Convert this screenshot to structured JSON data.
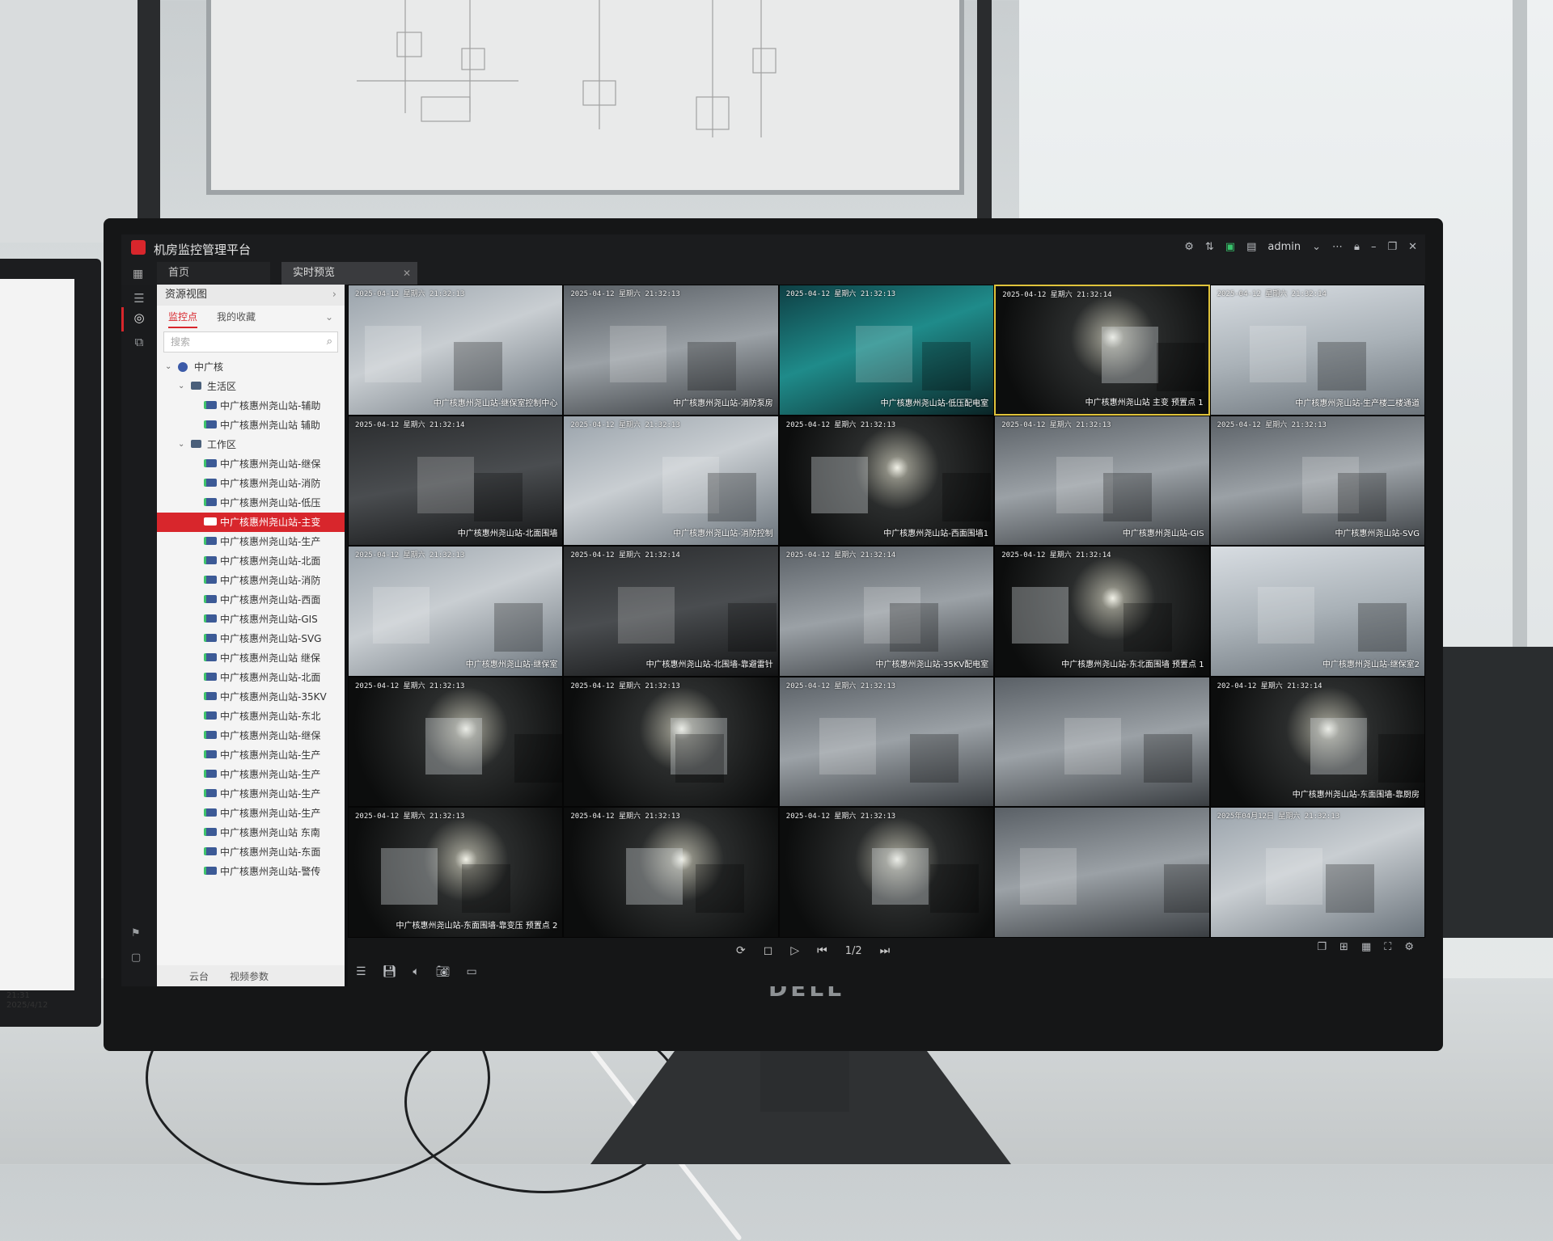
{
  "app": {
    "title": "机房监控管理平台",
    "user": "admin"
  },
  "tabs": [
    {
      "label": "首页"
    },
    {
      "label": "实时预览"
    }
  ],
  "panel": {
    "header": "资源视图",
    "subtabs": [
      "监控点",
      "我的收藏"
    ],
    "search_placeholder": "搜索",
    "footer": [
      "云台",
      "视频参数"
    ]
  },
  "tree": [
    {
      "label": "中广核",
      "level": 0,
      "expanded": true,
      "type": "root"
    },
    {
      "label": "生活区",
      "level": 1,
      "expanded": true,
      "type": "group"
    },
    {
      "label": "中广核惠州尧山站-辅助",
      "level": 2,
      "type": "cam"
    },
    {
      "label": "中广核惠州尧山站 辅助",
      "level": 2,
      "type": "cam"
    },
    {
      "label": "工作区",
      "level": 1,
      "expanded": true,
      "type": "group"
    },
    {
      "label": "中广核惠州尧山站-继保",
      "level": 2,
      "type": "cam"
    },
    {
      "label": "中广核惠州尧山站-消防",
      "level": 2,
      "type": "cam"
    },
    {
      "label": "中广核惠州尧山站-低压",
      "level": 2,
      "type": "cam"
    },
    {
      "label": "中广核惠州尧山站-主变",
      "level": 2,
      "type": "cam",
      "selected": true
    },
    {
      "label": "中广核惠州尧山站-生产",
      "level": 2,
      "type": "cam"
    },
    {
      "label": "中广核惠州尧山站-北面",
      "level": 2,
      "type": "cam"
    },
    {
      "label": "中广核惠州尧山站-消防",
      "level": 2,
      "type": "cam"
    },
    {
      "label": "中广核惠州尧山站-西面",
      "level": 2,
      "type": "cam"
    },
    {
      "label": "中广核惠州尧山站-GIS",
      "level": 2,
      "type": "cam"
    },
    {
      "label": "中广核惠州尧山站-SVG",
      "level": 2,
      "type": "cam"
    },
    {
      "label": "中广核惠州尧山站 继保",
      "level": 2,
      "type": "cam"
    },
    {
      "label": "中广核惠州尧山站-北面",
      "level": 2,
      "type": "cam"
    },
    {
      "label": "中广核惠州尧山站-35KV",
      "level": 2,
      "type": "cam"
    },
    {
      "label": "中广核惠州尧山站-东北",
      "level": 2,
      "type": "cam"
    },
    {
      "label": "中广核惠州尧山站-继保",
      "level": 2,
      "type": "cam"
    },
    {
      "label": "中广核惠州尧山站-生产",
      "level": 2,
      "type": "cam"
    },
    {
      "label": "中广核惠州尧山站-生产",
      "level": 2,
      "type": "cam"
    },
    {
      "label": "中广核惠州尧山站-生产",
      "level": 2,
      "type": "cam"
    },
    {
      "label": "中广核惠州尧山站-生产",
      "level": 2,
      "type": "cam"
    },
    {
      "label": "中广核惠州尧山站 东南",
      "level": 2,
      "type": "cam"
    },
    {
      "label": "中广核惠州尧山站-东面",
      "level": 2,
      "type": "cam"
    },
    {
      "label": "中广核惠州尧山站-警传",
      "level": 2,
      "type": "cam"
    }
  ],
  "cameras": [
    {
      "ts": "2025-04-12 星期六 21:32:13",
      "label": "中广核惠州尧山站-继保室控制中心",
      "scene": "bright"
    },
    {
      "ts": "2025-04-12 星期六 21:32:13",
      "label": "中广核惠州尧山站-消防泵房",
      "scene": "gray"
    },
    {
      "ts": "2025-04-12 星期六 21:32:13",
      "label": "中广核惠州尧山站-低压配电室",
      "scene": "teal"
    },
    {
      "ts": "2025-04-12 星期六 21:32:14",
      "label": "中广核惠州尧山站 主变 预置点 1",
      "scene": "night",
      "selected": true
    },
    {
      "ts": "2025-04-12 星期六 21:32:14",
      "label": "中广核惠州尧山站-生产楼二楼通道",
      "scene": "corridor"
    },
    {
      "ts": "2025-04-12 星期六 21:32:14",
      "label": "中广核惠州尧山站-北面围墙",
      "scene": "dark"
    },
    {
      "ts": "2025-04-12 星期六 21:32:13",
      "label": "中广核惠州尧山站-消防控制",
      "scene": "bright"
    },
    {
      "ts": "2025-04-12 星期六 21:32:13",
      "label": "中广核惠州尧山站-西面围墙1",
      "scene": "night"
    },
    {
      "ts": "2025-04-12 星期六 21:32:13",
      "label": "中广核惠州尧山站-GIS",
      "scene": "gray"
    },
    {
      "ts": "2025-04-12 星期六 21:32:13",
      "label": "中广核惠州尧山站-SVG",
      "scene": "gray"
    },
    {
      "ts": "2025-04-12 星期六 21:32:13",
      "label": "中广核惠州尧山站-继保室",
      "scene": "bright"
    },
    {
      "ts": "2025-04-12 星期六 21:32:14",
      "label": "中广核惠州尧山站-北围墙-靠避雷针",
      "scene": "dark"
    },
    {
      "ts": "2025-04-12 星期六 21:32:14",
      "label": "中广核惠州尧山站-35KV配电室",
      "scene": "gray"
    },
    {
      "ts": "2025-04-12 星期六 21:32:14",
      "label": "中广核惠州尧山站-东北面围墙 预置点 1",
      "scene": "night"
    },
    {
      "ts": "",
      "label": "中广核惠州尧山站-继保室2",
      "scene": "corridor"
    },
    {
      "ts": "2025-04-12 星期六 21:32:13",
      "label": "",
      "scene": "night"
    },
    {
      "ts": "2025-04-12 星期六 21:32:13",
      "label": "",
      "scene": "night"
    },
    {
      "ts": "2025-04-12 星期六 21:32:13",
      "label": "",
      "scene": "gray"
    },
    {
      "ts": "",
      "label": "",
      "scene": "gray"
    },
    {
      "ts": "202-04-12 星期六 21:32:14",
      "label": "中广核惠州尧山站-东面围墙-靠厨房",
      "scene": "night"
    },
    {
      "ts": "2025-04-12 星期六 21:32:13",
      "label": "中广核惠州尧山站-东面围墙-靠变压 预置点 2",
      "scene": "night"
    },
    {
      "ts": "2025-04-12 星期六 21:32:13",
      "label": "",
      "scene": "night"
    },
    {
      "ts": "2025-04-12 星期六 21:32:13",
      "label": "",
      "scene": "night"
    },
    {
      "ts": "",
      "label": "",
      "scene": "gray"
    },
    {
      "ts": "2025年04月12日 星期六 21:32:13",
      "label": "",
      "scene": "bright"
    }
  ],
  "toolbar": {
    "page": "1/2"
  },
  "left_monitor_clock": {
    "time": "21:31",
    "date": "2025/4/12"
  },
  "brand": "DELL",
  "colors": {
    "accent": "#d8262c",
    "selected_cell": "#e0c33b"
  }
}
